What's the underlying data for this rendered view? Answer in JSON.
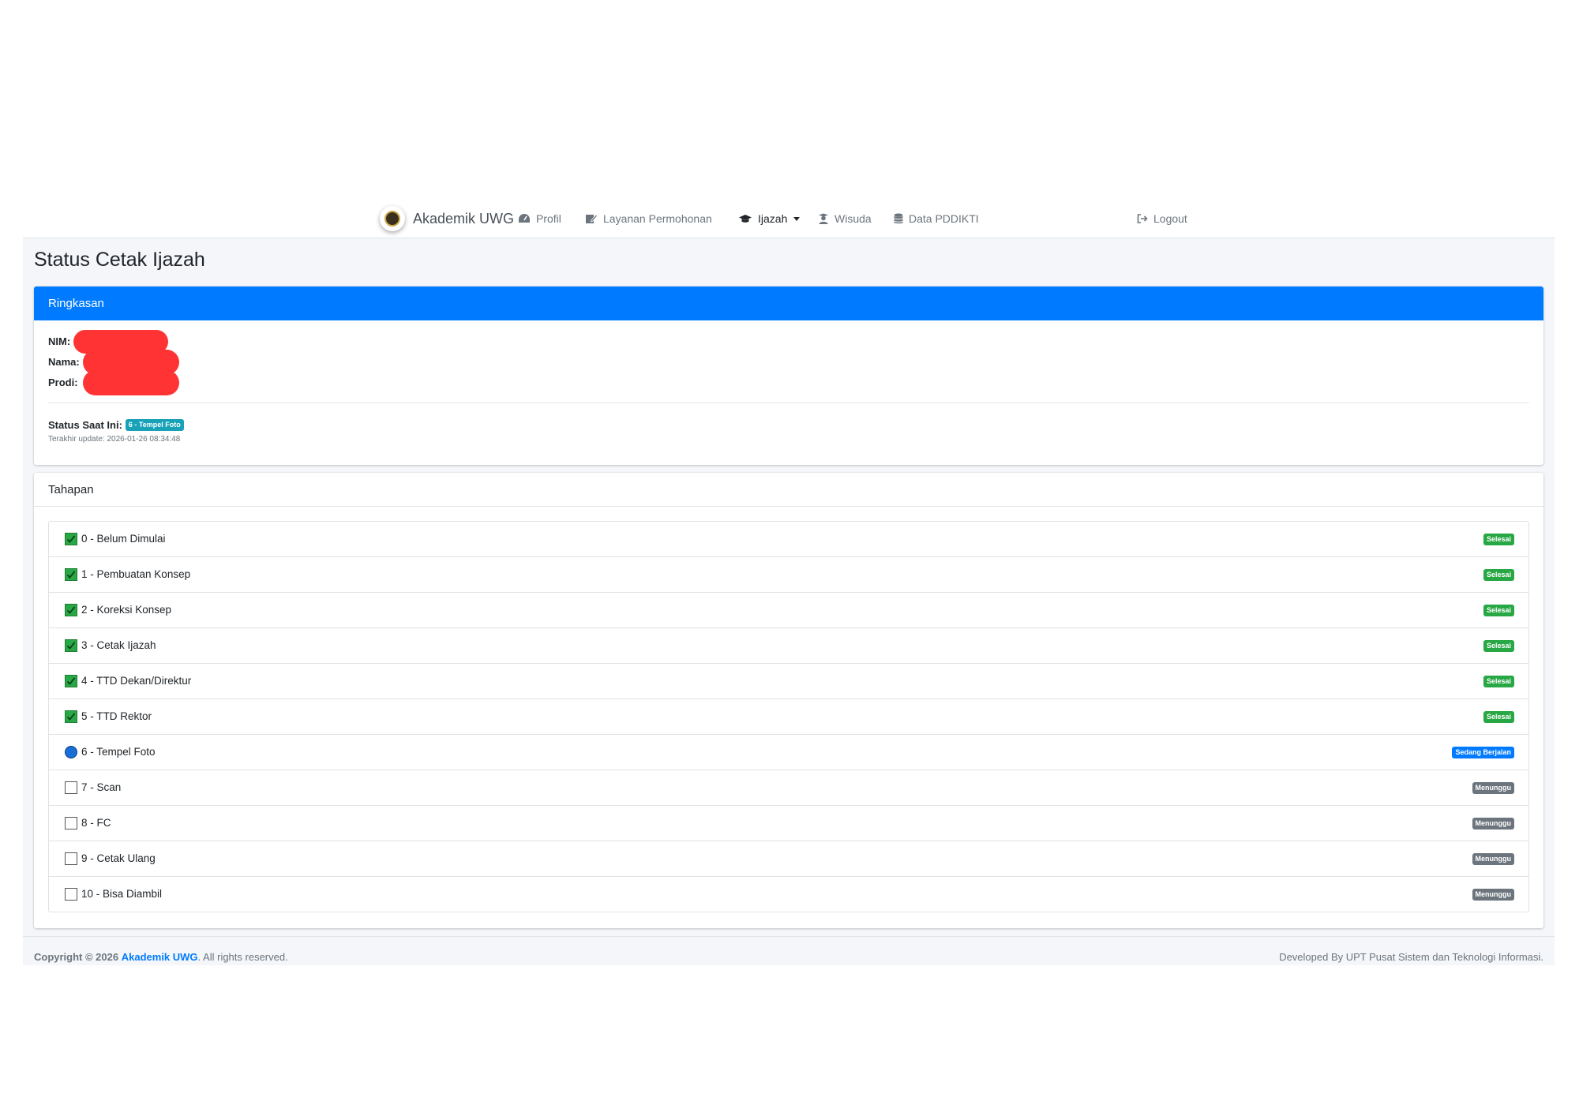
{
  "brand": {
    "name": "Akademik UWG"
  },
  "nav": {
    "profil": "Profil",
    "layanan": "Layanan Permohonan",
    "ijazah": "Ijazah",
    "wisuda": "Wisuda",
    "pddikti": "Data PDDIKTI",
    "logout": "Logout"
  },
  "page": {
    "title": "Status Cetak Ijazah"
  },
  "summary": {
    "header": "Ringkasan",
    "nim_label": "NIM:",
    "nama_label": "Nama:",
    "prodi_label": "Prodi:",
    "status_label": "Status Saat Ini:",
    "status_badge": "6 - Tempel Foto",
    "last_update": "Terakhir update: 2026-01-26 08:34:48"
  },
  "stages": {
    "header": "Tahapan",
    "items": [
      {
        "label": "0 - Belum Dimulai",
        "status": "Selesai",
        "state": "done"
      },
      {
        "label": "1 - Pembuatan Konsep",
        "status": "Selesai",
        "state": "done"
      },
      {
        "label": "2 - Koreksi Konsep",
        "status": "Selesai",
        "state": "done"
      },
      {
        "label": "3 - Cetak Ijazah",
        "status": "Selesai",
        "state": "done"
      },
      {
        "label": "4 - TTD Dekan/Direktur",
        "status": "Selesai",
        "state": "done"
      },
      {
        "label": "5 - TTD Rektor",
        "status": "Selesai",
        "state": "done"
      },
      {
        "label": "6 - Tempel Foto",
        "status": "Sedang Berjalan",
        "state": "run"
      },
      {
        "label": "7 - Scan",
        "status": "Menunggu",
        "state": "wait"
      },
      {
        "label": "8 - FC",
        "status": "Menunggu",
        "state": "wait"
      },
      {
        "label": "9 - Cetak Ulang",
        "status": "Menunggu",
        "state": "wait"
      },
      {
        "label": "10 - Bisa Diambil",
        "status": "Menunggu",
        "state": "wait"
      }
    ]
  },
  "footer": {
    "copyright_prefix": "Copyright © 2026",
    "copyright_link": "Akademik UWG",
    "copyright_suffix": ". All rights reserved.",
    "developed": "Developed By UPT Pusat Sistem dan Teknologi Informasi."
  },
  "colors": {
    "primary": "#007bff",
    "success": "#28a745",
    "info": "#17a2b8",
    "secondary": "#6c757d",
    "redaction": "#ff3333"
  }
}
